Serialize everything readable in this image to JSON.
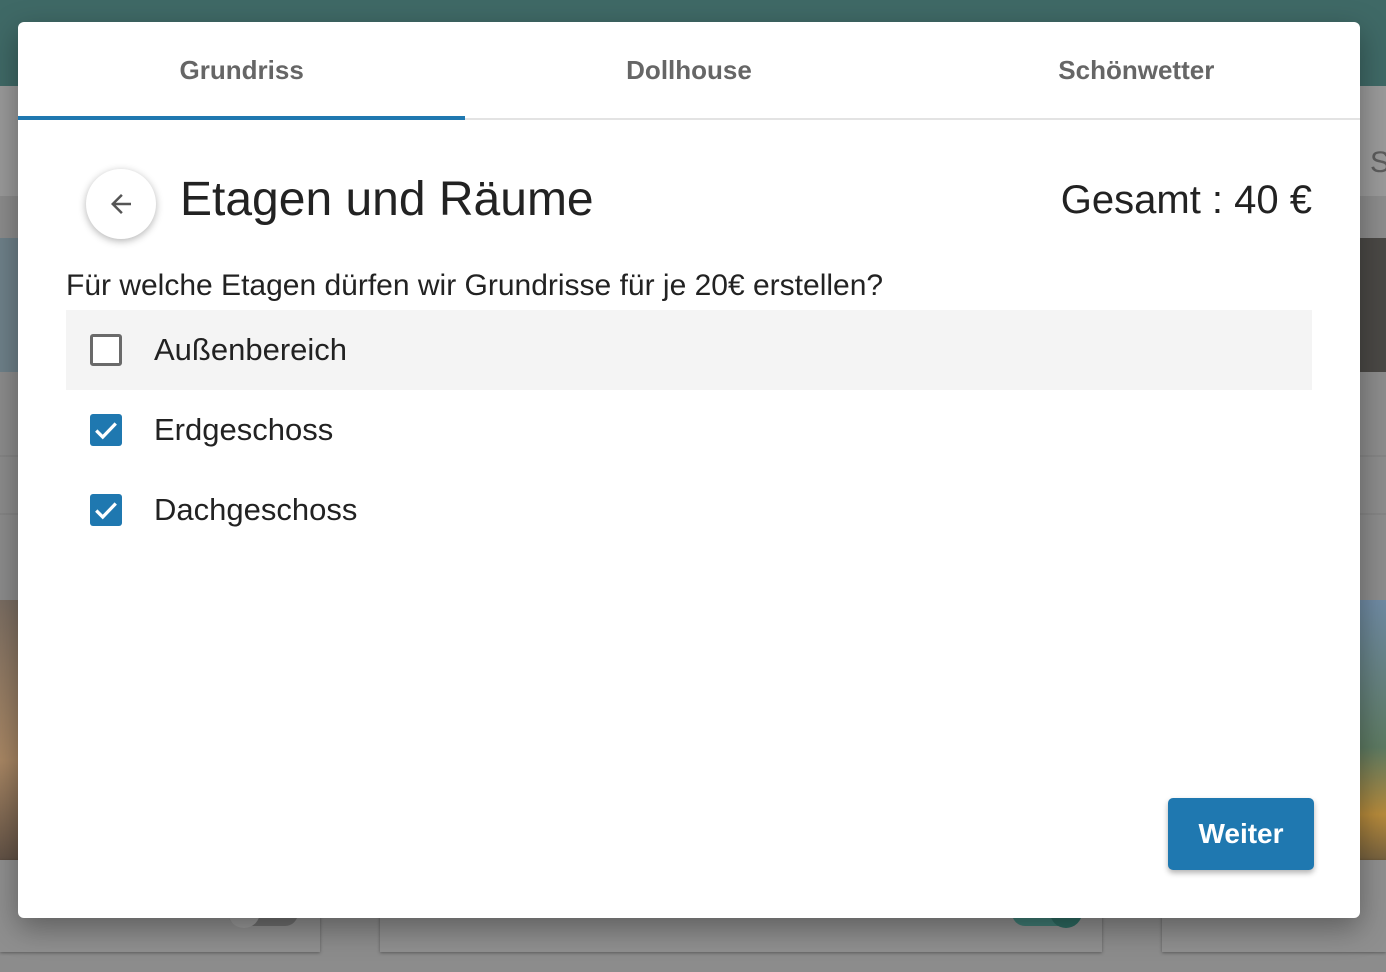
{
  "tabs": [
    {
      "label": "Grundriss",
      "active": true
    },
    {
      "label": "Dollhouse",
      "active": false
    },
    {
      "label": "Schönwetter",
      "active": false
    }
  ],
  "header": {
    "back_icon": "arrow-left-icon",
    "title": "Etagen und Räume",
    "total": "Gesamt : 40 €"
  },
  "question": "Für welche Etagen dürfen wir Grundrisse für je 20€ erstellen?",
  "options": [
    {
      "label": "Außenbereich",
      "checked": false
    },
    {
      "label": "Erdgeschoss",
      "checked": true
    },
    {
      "label": "Dachgeschoss",
      "checked": true
    }
  ],
  "next_label": "Weiter",
  "colors": {
    "accent": "#1f78b0",
    "header_bg": "#3f6966",
    "text": "#222222"
  },
  "background": {
    "edge_text": "S"
  }
}
